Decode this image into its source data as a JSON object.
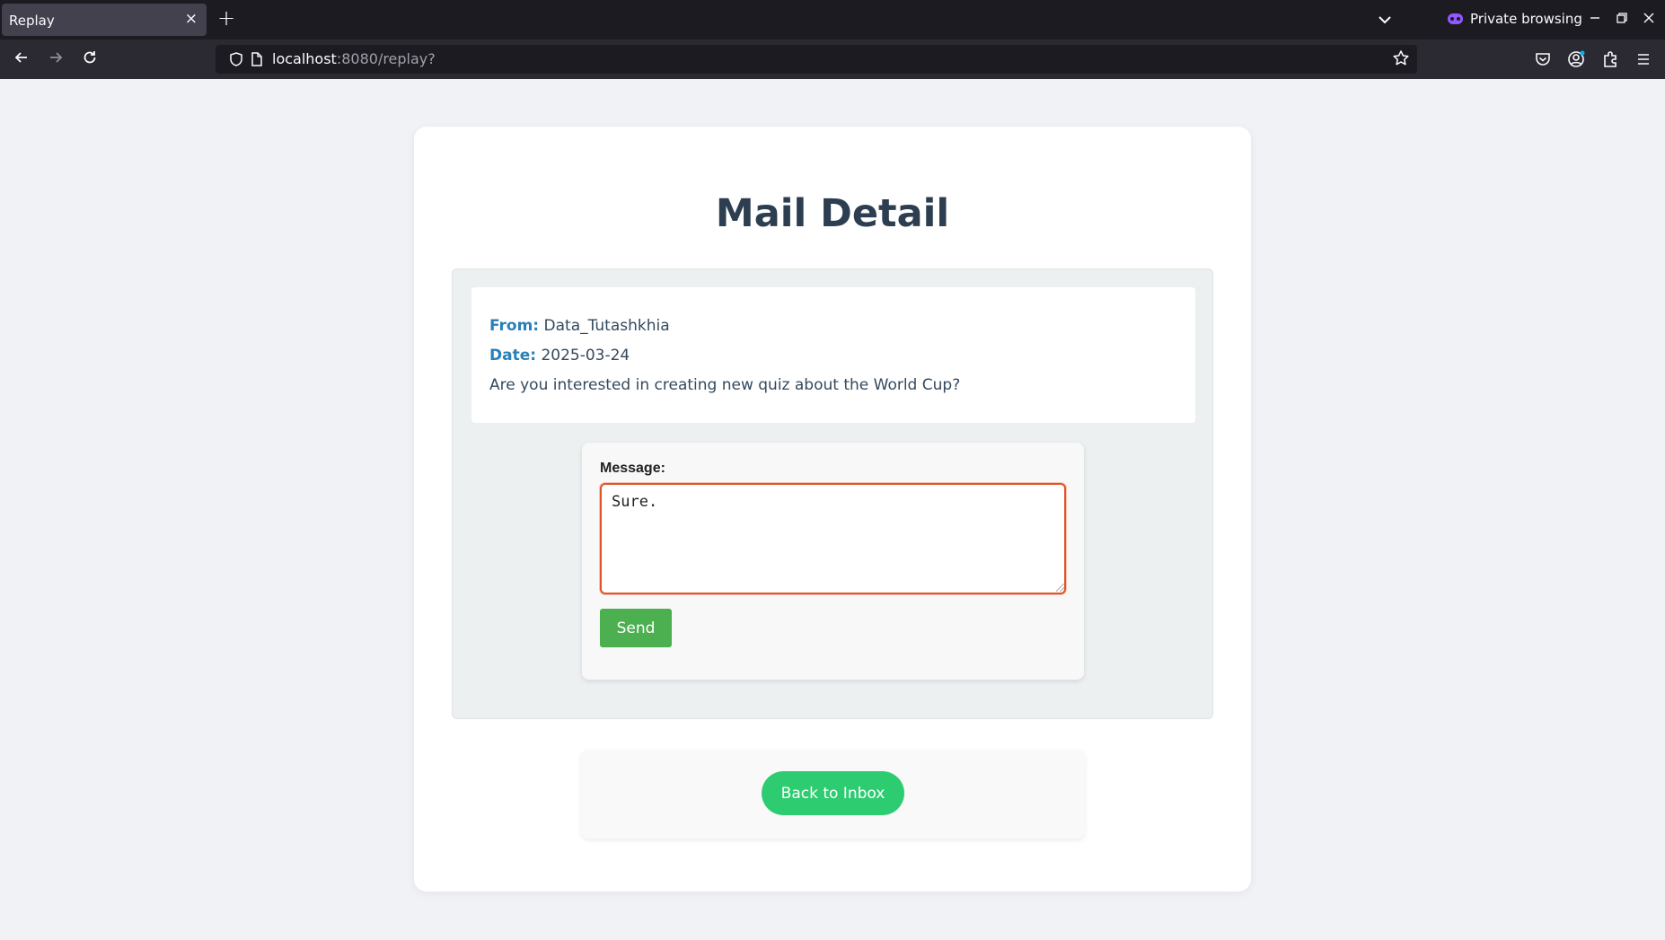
{
  "browser": {
    "tab_title": "Replay",
    "tab_close": "×",
    "new_tab": "+",
    "private_label": "Private browsing",
    "url_host": "localhost",
    "url_path": ":8080/replay?"
  },
  "page": {
    "title": "Mail Detail",
    "mail": {
      "from_label": "From:",
      "from_value": "Data_Tutashkhia",
      "date_label": "Date:",
      "date_value": "2025-03-24",
      "body": "Are you interested in creating new quiz about the World Cup?"
    },
    "reply": {
      "message_label": "Message:",
      "message_value": "Sure.",
      "send_label": "Send"
    },
    "back_label": "Back to Inbox"
  },
  "colors": {
    "accent_key": "#2980b9",
    "send_button": "#4caf50",
    "back_button": "#2ecc71",
    "focus_border": "#e0542a"
  }
}
